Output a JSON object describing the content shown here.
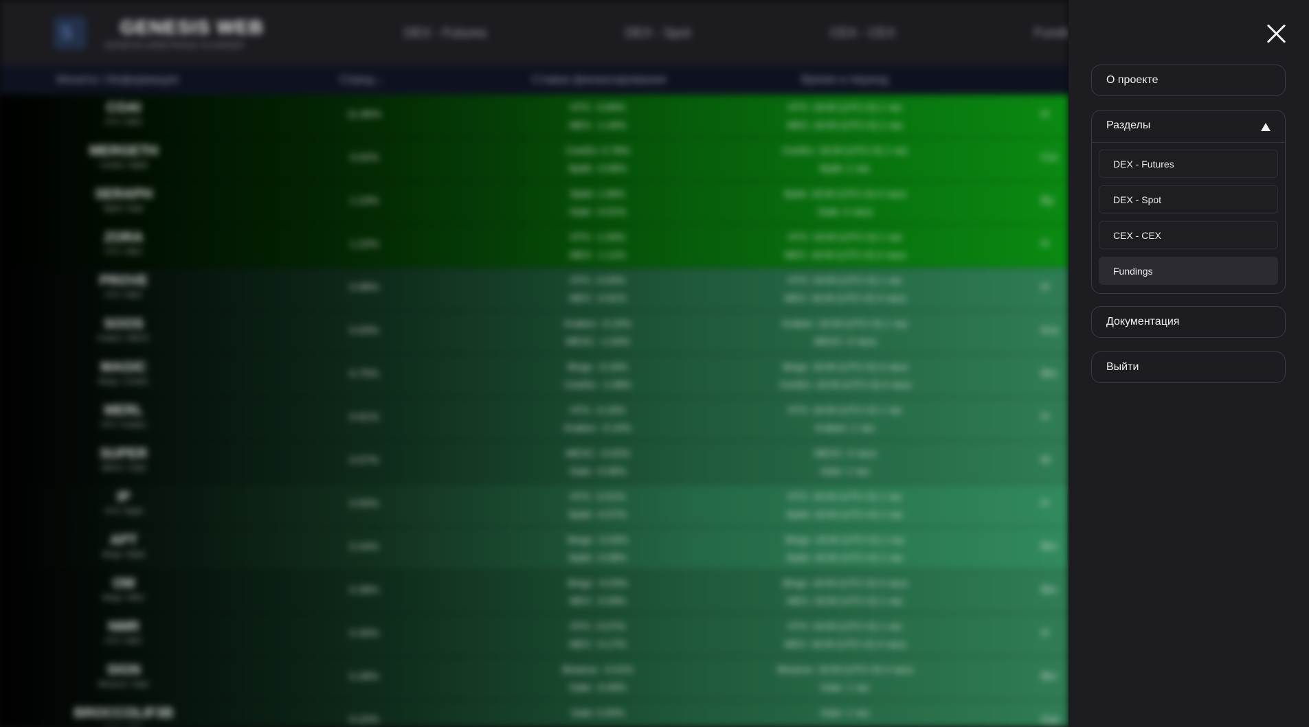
{
  "app": {
    "brand": "GENESIS WEB",
    "brand_subtitle": "GENESIS ARBITRAGE SCANNER",
    "nav": [
      "DEX - Futures",
      "DEX - Spot",
      "CEX - CEX",
      "Fundings"
    ]
  },
  "table": {
    "headers": [
      "Монета / Информация",
      "Спред ↓",
      "Ставка финансирования",
      "Время и период"
    ],
    "rows": [
      {
        "coin": "COAI",
        "pair": "HTX / MEX",
        "spread": "11.86%",
        "fund": [
          "HTX: -0.69%",
          "MEX: -1.44%"
        ],
        "time": [
          "HTX: 18:00 (UTC+3) 1 час",
          "MEX: 18:00 (UTC+3) 1 час"
        ],
        "exchange": "H",
        "style": "green"
      },
      {
        "coin": "MERGETH",
        "pair": "CoinEx / Bybit",
        "spread": "3.02%",
        "fund": [
          "CoinEx: 0.78%",
          "Bybit: -0.06%"
        ],
        "time": [
          "CoinEx: 18:00 (UTC+3) 1 час",
          "Bybit: 1 час"
        ],
        "exchange": "Coi",
        "style": "green"
      },
      {
        "coin": "SERAPH",
        "pair": "Bybit / Gate",
        "spread": "1.23%",
        "fund": [
          "Bybit: 1.06%",
          "Gate: -0.01%"
        ],
        "time": [
          "Bybit: 18:00 (UTC+3) 4 часа",
          "Gate: 4 часа"
        ],
        "exchange": "By",
        "style": "green"
      },
      {
        "coin": "ZORA",
        "pair": "HTX / MEX",
        "spread": "1.22%",
        "fund": [
          "HTX: -1.00%",
          "MEX: -1.11%"
        ],
        "time": [
          "HTX: 18:00 (UTC+3) 1 час",
          "MEX: 18:00 (UTC+3) 4 часа"
        ],
        "exchange": "H",
        "style": "green"
      },
      {
        "coin": "PROVE",
        "pair": "HTX / MEX",
        "spread": "0.98%",
        "fund": [
          "HTX: -0.05%",
          "MEX: -0.91%"
        ],
        "time": [
          "HTX: 18:00 (UTC+3) 1 час",
          "MEX: 18:00 (UTC+3) 4 часа"
        ],
        "exchange": "H",
        "style": "teal"
      },
      {
        "coin": "SOOS",
        "pair": "Kraken / MEXC",
        "spread": "0.63%",
        "fund": [
          "Kraken: -0.10%",
          "MEXC: -1.04%"
        ],
        "time": [
          "Kraken: 18:00 (UTC+3) 1 час",
          "MEXC: 4 часа"
        ],
        "exchange": "Kra",
        "style": "teal"
      },
      {
        "coin": "MAGIC",
        "pair": "Bingx / CoinEx",
        "spread": "0.75%",
        "fund": [
          "Bingx: -0.16%",
          "CoinEx: -1.08%"
        ],
        "time": [
          "Bingx: 18:00 (UTC+3) 4 часа",
          "CoinEx: 18:00 (UTC+3) 4 часа"
        ],
        "exchange": "Bin",
        "style": "teal"
      },
      {
        "coin": "MERL",
        "pair": "HTX / Kraken",
        "spread": "0.61%",
        "fund": [
          "HTX: -0.16%",
          "Kraken: -0.10%"
        ],
        "time": [
          "HTX: 18:00 (UTC+3) 1 час",
          "Kraken: 1 час"
        ],
        "exchange": "H",
        "style": "teal"
      },
      {
        "coin": "SUPER",
        "pair": "MEXC / Gate",
        "spread": "0.57%",
        "fund": [
          "MEXC: -0.02%",
          "Gate: -0.06%"
        ],
        "time": [
          "MEXC: 4 часа",
          "Gate: 1 час"
        ],
        "exchange": "M",
        "style": "teal"
      },
      {
        "coin": "IP",
        "pair": "HTX / Bybit",
        "spread": "0.55%",
        "fund": [
          "HTX: -0.01%",
          "Bybit: -0.07%"
        ],
        "time": [
          "HTX: 18:00 (UTC+3) 1 час",
          "Bybit: 18:00 (UTC+3) 1 час"
        ],
        "exchange": "H",
        "style": "teal2"
      },
      {
        "coin": "APT",
        "pair": "Bingx / Bybit",
        "spread": "0.44%",
        "fund": [
          "Bingx: -0.04%",
          "Bybit: -0.08%"
        ],
        "time": [
          "Bingx: 18:00 (UTC+3) 1 час",
          "Bybit: 18:00 (UTC+3) 1 час"
        ],
        "exchange": "Bin",
        "style": "teal2"
      },
      {
        "coin": "OM",
        "pair": "Bingx / MEX",
        "spread": "0.38%",
        "fund": [
          "Bingx: -0.03%",
          "MEX: -0.09%"
        ],
        "time": [
          "Bingx: 18:00 (UTC+3) 4 часа",
          "MEX: 18:00 (UTC+3) 1 час"
        ],
        "exchange": "Bin",
        "style": "teal"
      },
      {
        "coin": "NMR",
        "pair": "HTX / MEX",
        "spread": "0.30%",
        "fund": [
          "HTX: -0.07%",
          "MEX: -0.17%"
        ],
        "time": [
          "HTX: 18:00 (UTC+3) 1 час",
          "MEX: 18:00 (UTC+3) 4 часа"
        ],
        "exchange": "H",
        "style": "teal"
      },
      {
        "coin": "SIGN",
        "pair": "Binance / Gate",
        "spread": "0.28%",
        "fund": [
          "Binance: -0.01%",
          "Gate: -0.09%"
        ],
        "time": [
          "Binance: 18:00 (UTC+3) 4 часа",
          "Gate: 1 час"
        ],
        "exchange": "Bin",
        "style": "teal"
      },
      {
        "coin": "BROCCOLIF3B",
        "pair": "Gate / HTX",
        "spread": "0.22%",
        "fund": [
          "Gate: 0.00%",
          ""
        ],
        "time": [
          "Gate: 1 час",
          ""
        ],
        "exchange": "Gat",
        "style": "teal"
      }
    ]
  },
  "drawer": {
    "about": "О проекте",
    "sections_label": "Разделы",
    "sections": [
      "DEX - Futures",
      "DEX - Spot",
      "CEX - CEX",
      "Fundings"
    ],
    "active_section": "Fundings",
    "docs": "Документация",
    "logout": "Выйти"
  }
}
